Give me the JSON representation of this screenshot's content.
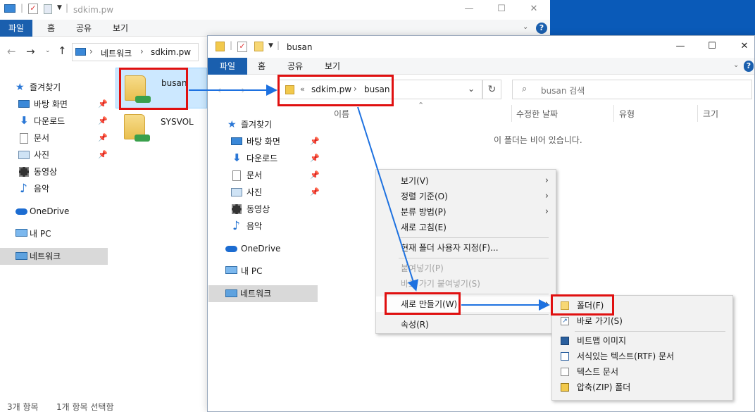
{
  "colors": {
    "accent": "#1a5fae",
    "annotation_red": "#e01010",
    "annotation_blue": "#1d71e0",
    "desktop": "#0a5ab8"
  },
  "back_window": {
    "title": "sdkim.pw",
    "tabs": [
      "파일",
      "홈",
      "공유",
      "보기"
    ],
    "breadcrumb": [
      "네트워크",
      "sdkim.pw"
    ],
    "nav_pane": [
      {
        "label": "즐겨찾기",
        "icon": "star-icon"
      },
      {
        "label": "바탕 화면",
        "icon": "desktop-icon",
        "pinned": true
      },
      {
        "label": "다운로드",
        "icon": "download-icon",
        "pinned": true
      },
      {
        "label": "문서",
        "icon": "document-icon",
        "pinned": true
      },
      {
        "label": "사진",
        "icon": "pictures-icon",
        "pinned": true
      },
      {
        "label": "동영상",
        "icon": "video-icon"
      },
      {
        "label": "음악",
        "icon": "music-icon"
      },
      {
        "label": "OneDrive",
        "icon": "onedrive-icon"
      },
      {
        "label": "내 PC",
        "icon": "pc-icon"
      },
      {
        "label": "네트워크",
        "icon": "network-icon"
      }
    ],
    "files": [
      "busan",
      "SYSVOL"
    ],
    "status": [
      "3개 항목",
      "1개 항목 선택함"
    ]
  },
  "front_window": {
    "title": "busan",
    "tabs": [
      "파일",
      "홈",
      "공유",
      "보기"
    ],
    "breadcrumb_prefix": "«",
    "breadcrumb": [
      "sdkim.pw",
      "busan"
    ],
    "search_placeholder": "busan 검색",
    "columns": [
      "이름",
      "수정한 날짜",
      "유형",
      "크기"
    ],
    "empty_message": "이 폴더는 비어 있습니다.",
    "nav_pane": [
      {
        "label": "즐겨찾기",
        "icon": "star-icon"
      },
      {
        "label": "바탕 화면",
        "icon": "desktop-icon",
        "pinned": true
      },
      {
        "label": "다운로드",
        "icon": "download-icon",
        "pinned": true
      },
      {
        "label": "문서",
        "icon": "document-icon",
        "pinned": true
      },
      {
        "label": "사진",
        "icon": "pictures-icon",
        "pinned": true
      },
      {
        "label": "동영상",
        "icon": "video-icon"
      },
      {
        "label": "음악",
        "icon": "music-icon"
      },
      {
        "label": "OneDrive",
        "icon": "onedrive-icon"
      },
      {
        "label": "내 PC",
        "icon": "pc-icon"
      },
      {
        "label": "네트워크",
        "icon": "network-icon"
      }
    ]
  },
  "context_menu": {
    "items": [
      {
        "label": "보기(V)",
        "submenu": true
      },
      {
        "label": "정렬 기준(O)",
        "submenu": true
      },
      {
        "label": "분류 방법(P)",
        "submenu": true
      },
      {
        "label": "새로 고침(E)"
      },
      {
        "label": "현재 폴더 사용자 지정(F)..."
      },
      {
        "label": "붙여넣기(P)",
        "disabled": true
      },
      {
        "label": "바로 가기 붙여넣기(S)",
        "disabled": true
      },
      {
        "label": "새로 만들기(W)",
        "submenu": true
      },
      {
        "label": "속성(R)"
      }
    ]
  },
  "new_submenu": {
    "items": [
      {
        "label": "폴더(F)",
        "icon": "folder-icon"
      },
      {
        "label": "바로 가기(S)",
        "icon": "shortcut-icon"
      },
      {
        "label": "비트맵 이미지",
        "icon": "bitmap-icon"
      },
      {
        "label": "서식있는 텍스트(RTF) 문서",
        "icon": "rtf-icon"
      },
      {
        "label": "텍스트 문서",
        "icon": "text-document-icon"
      },
      {
        "label": "압축(ZIP) 폴더",
        "icon": "zip-folder-icon"
      }
    ]
  }
}
